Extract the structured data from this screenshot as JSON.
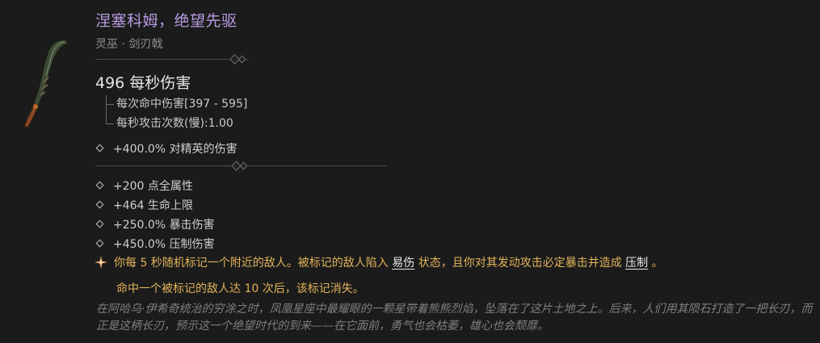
{
  "item": {
    "name": "涅塞科姆，绝望先驱",
    "type": "灵巫 · 剑刃戟",
    "dps": "496 每秒伤害",
    "damage_per_hit": "每次命中伤害[397 - 595]",
    "attacks_per_second": "每秒攻击次数(慢):1.00",
    "implicit": "+400.0% 对精英的伤害",
    "affixes": [
      "+200 点全属性",
      "+464 生命上限",
      "+250.0% 暴击伤害",
      "+450.0% 压制伤害"
    ],
    "legendary": {
      "part1": "你每 5 秒随机标记一个附近的敌人。被标记的敌人陷入 ",
      "keyword1": "易伤",
      "part2": " 状态，且你对其发动攻击必定暴击并造成 ",
      "keyword2": "压制",
      "part3": " 。",
      "line2": "命中一个被标记的敌人达 10 次后，该标记消失。"
    },
    "flavor_text": "在阿哈乌·伊希奇统治的穷涂之时，凤凰星座中最耀眼的一颗星带着熊熊烈焰，坠落在了这片土地之上。后来，人们用其陨石打造了一把长刃，而正是这柄长刃，预示这一个绝望时代的到来——在它面前，勇气也会枯萎，雄心也会颓靡。"
  },
  "colors": {
    "background": "#1b1b1b",
    "name": "#b79be0",
    "legendary": "#e2b35a",
    "flavor": "#7f7f7f"
  },
  "icons": {
    "weapon": "scythe-blade-icon",
    "affix_bullet": "diamond-bullet-icon",
    "legendary_bullet": "star-burst-icon"
  }
}
